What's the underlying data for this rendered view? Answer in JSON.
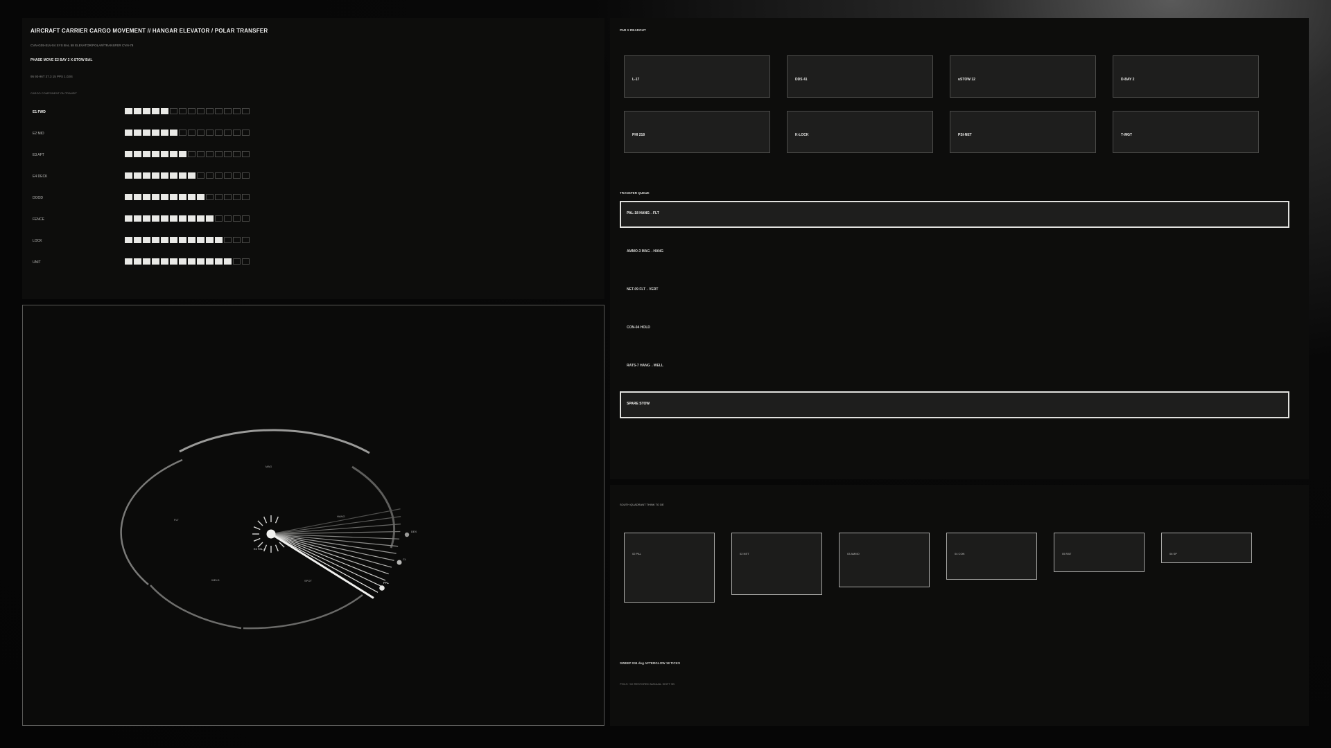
{
  "ledger": {
    "title": "AIRCRAFT CARRIER CARGO MOVEMENT  //  HANGAR ELEVATOR / POLAR TRANSFER",
    "meta_line": "CVN-G05-ELV-04   SYS BAL 58   ELEVATOR/POLAR/TRANSFER   CVN-78",
    "phase_line": "PHASE MOVE   E2 BAY 2   X-STOW   BAL",
    "reading_line": "95  93-96T  37.3  15 PPS  1.02/4",
    "section_line": "CARGO COMPONENT   ON TRANSIT",
    "rows": [
      {
        "label": "E1 FWD",
        "filled": 5,
        "bold": true
      },
      {
        "label": "E2 MID",
        "filled": 6,
        "bold": false
      },
      {
        "label": "E3 AFT",
        "filled": 7,
        "bold": false
      },
      {
        "label": "E4 DECK",
        "filled": 8,
        "bold": false
      },
      {
        "label": "DOOD",
        "filled": 9,
        "bold": false
      },
      {
        "label": "FENCE",
        "filled": 10,
        "bold": false
      },
      {
        "label": "LOCK",
        "filled": 11,
        "bold": false
      },
      {
        "label": "UNIT",
        "filled": 12,
        "bold": false
      }
    ],
    "total_cells": 14
  },
  "radar": {
    "labels": {
      "center": "E2 PAL-6",
      "top": "MAG",
      "left": "FLT",
      "right_upper": "HANG",
      "lower_left": "WELD",
      "lower_mid": "SPOT",
      "p1": "DEX",
      "p2": "CL",
      "p3": "PAL"
    },
    "sweep_count": 14
  },
  "readout": {
    "label": "PAR X READOUT",
    "tiles": [
      "L-17",
      "DDS 41",
      "uSTOW 12",
      "D-BAY 2",
      "PHI 218",
      "K-LOCK",
      "PSI-NET",
      "T-WGT"
    ],
    "queue_label": "TRANSFER QUEUE",
    "queue": [
      {
        "text": "PAL-18  HANG→FLT",
        "highlight": true
      },
      {
        "text": "AMMO-3  MAG→HANG",
        "highlight": false
      },
      {
        "text": "NET-09  FLT→VERT",
        "highlight": false
      },
      {
        "text": "CON-04  HOLD",
        "highlight": false
      },
      {
        "text": "RATS-7  HANG→WELL",
        "highlight": false
      },
      {
        "text": "SPARE  STOW",
        "highlight": true
      }
    ]
  },
  "gauge": {
    "label": "SOUTH QUADRANT   THINK TO DE",
    "boxes": [
      {
        "text": "02 PAL",
        "level": 1.0
      },
      {
        "text": "02 NET",
        "level": 0.89
      },
      {
        "text": "03 AMMO",
        "level": 0.78
      },
      {
        "text": "04 CON",
        "level": 0.67
      },
      {
        "text": "05 RAT",
        "level": 0.56
      },
      {
        "text": "06 SP",
        "level": 0.44
      }
    ],
    "footer1": "SWEEP  034 deg   AFTERGLOW  18 TICKS",
    "footer2": "PHILS  +02   RESTORED MANUAL   SHIFT 9B"
  },
  "colors": {
    "background": "#0d0d0c",
    "tile": "#1e1e1d",
    "accent": "#e9e9e6",
    "border": "#4c4c4a"
  }
}
